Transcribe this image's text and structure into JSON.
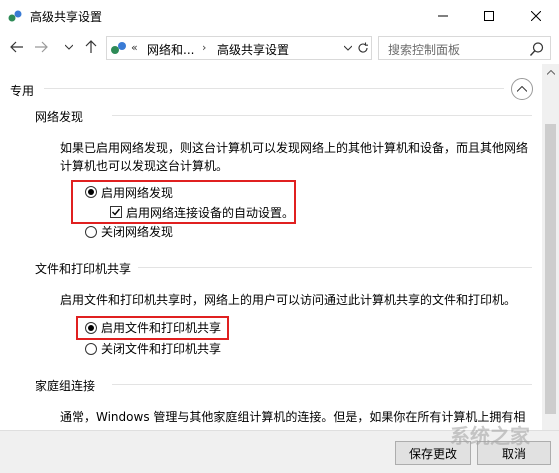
{
  "window": {
    "title": "高级共享设置"
  },
  "address": {
    "overflow": "«",
    "crumb1": "网络和...",
    "separator": "›",
    "crumb2": "高级共享设置"
  },
  "search": {
    "placeholder": "搜索控制面板"
  },
  "profile": {
    "label": "专用"
  },
  "network_discovery": {
    "heading": "网络发现",
    "desc_line1": "如果已启用网络发现，则这台计算机可以发现网络上的其他计算机和设备，而且其他网络",
    "desc_line2": "计算机也可以发现这台计算机。",
    "option_on": "启用网络发现",
    "auto_setup": "启用网络连接设备的自动设置。",
    "option_off": "关闭网络发现"
  },
  "file_sharing": {
    "heading": "文件和打印机共享",
    "desc": "启用文件和打印机共享时，网络上的用户可以访问通过此计算机共享的文件和打印机。",
    "option_on": "启用文件和打印机共享",
    "option_off": "关闭文件和打印机共享"
  },
  "homegroup": {
    "heading": "家庭组连接",
    "desc": "通常，Windows 管理与其他家庭组计算机的连接。但是，如果你在所有计算机上拥有相"
  },
  "footer": {
    "save": "保存更改",
    "cancel": "取消"
  },
  "watermark": "系统之家",
  "colors": {
    "highlight": "#e02020",
    "footer_bg": "#f0f0f0",
    "scroll_thumb": "#cdcdcd"
  }
}
